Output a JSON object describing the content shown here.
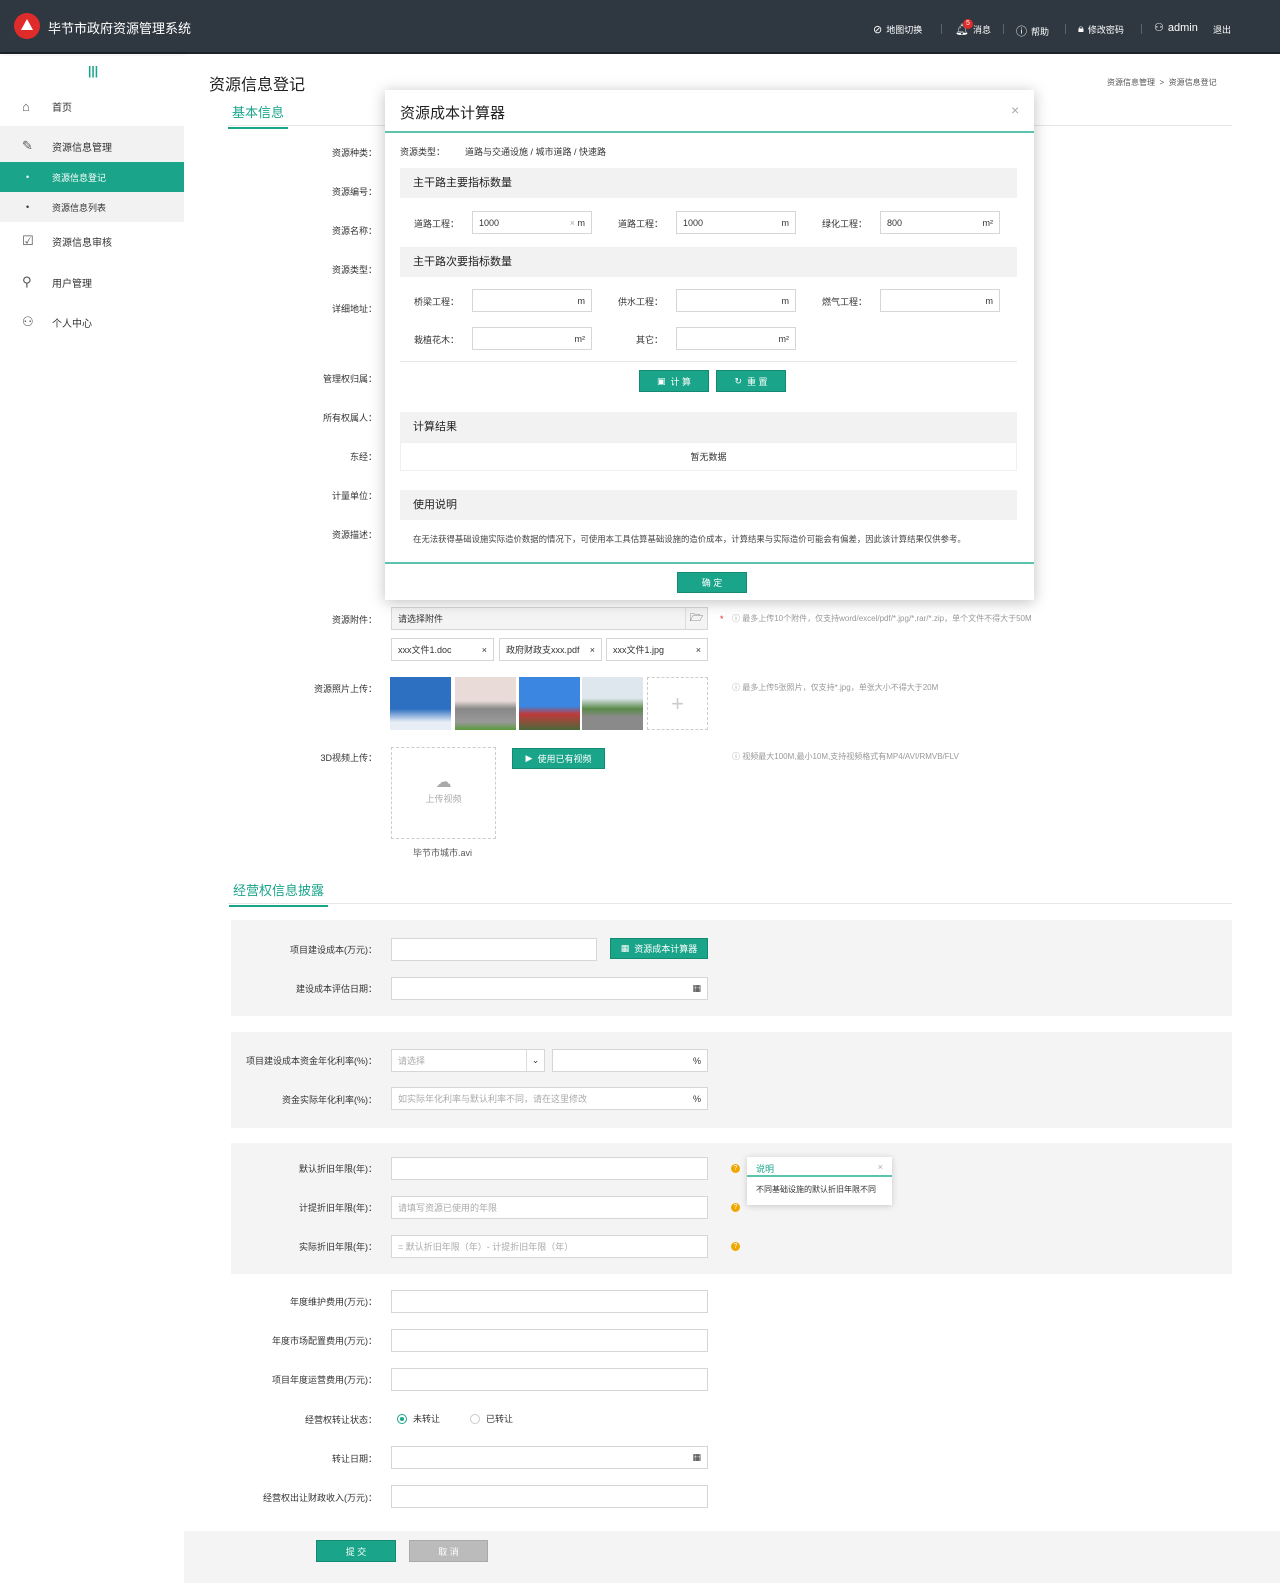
{
  "header": {
    "title": "毕节市政府资源管理系统",
    "nav": [
      {
        "icon": "map-switch-icon",
        "label": "地图切换"
      },
      {
        "icon": "bell-icon",
        "label": "消息",
        "badge": "5"
      },
      {
        "icon": "help-icon",
        "label": "帮助"
      },
      {
        "icon": "lock-icon",
        "label": "修改密码"
      },
      {
        "icon": "user-icon",
        "label": "admin"
      }
    ],
    "logout": "退出"
  },
  "sidebar": {
    "toggle": "|||",
    "items": [
      {
        "icon": "home-icon",
        "label": "首页"
      },
      {
        "icon": "edit-doc-icon",
        "label": "资源信息管理"
      },
      {
        "icon": "audit-icon",
        "label": "资源信息审核"
      },
      {
        "icon": "user-manage-icon",
        "label": "用户管理"
      },
      {
        "icon": "person-icon",
        "label": "个人中心"
      }
    ],
    "subitems": [
      {
        "label": "资源信息登记"
      },
      {
        "label": "资源信息列表"
      }
    ]
  },
  "page": {
    "title": "资源信息登记",
    "breadcrumb": [
      "资源信息管理",
      ">",
      "资源信息登记"
    ],
    "tab_basic": "基本信息",
    "tab_oper": "经营权信息披露"
  },
  "basic": {
    "labels": [
      "资源种类：",
      "资源编号：",
      "资源名称：",
      "资源类型：",
      "详细地址：",
      "管理权归属：",
      "所有权属人：",
      "东经：",
      "计量单位：",
      "资源描述："
    ],
    "attach_label": "资源附件：",
    "attach_placeholder": "请选择附件",
    "attach_tip": "最多上传10个附件，仅支持word/excel/pdf/*.jpg/*.rar/*.zip，单个文件不得大于50M",
    "files": [
      "xxx文件1.doc",
      "政府财政支xxx.pdf",
      "xxx文件1.jpg"
    ],
    "photo_label": "资源照片上传：",
    "photo_tip": "最多上传5张照片，仅支持*.jpg，单张大小不得大于20M",
    "video_label": "3D视频上传：",
    "video_upload": "上传视频",
    "video_use": "使用已有视频",
    "video_tip": "视频最大100M,最小10M,支持视频格式有MP4/AVI/RMVB/FLV",
    "video_file": "毕节市城市.avi"
  },
  "oper": {
    "cost_label": "项目建设成本(万元)：",
    "calc_button": "资源成本计算器",
    "eval_date_label": "建设成本评估日期：",
    "rate_label": "项目建设成本资金年化利率(%)：",
    "rate_select": "请选择",
    "pct": "%",
    "actual_rate_label": "资金实际年化利率(%)：",
    "actual_rate_placeholder": "如实际年化利率与默认利率不同，请在这里修改",
    "dep_default_label": "默认折旧年限(年)：",
    "dep_used_label": "计提折旧年限(年)：",
    "dep_used_placeholder": "请填写资源已使用的年限",
    "dep_actual_label": "实际折旧年限(年)：",
    "dep_actual_placeholder": "= 默认折旧年限（年）- 计提折旧年限（年）",
    "popover_title": "说明",
    "popover_text": "不同基础设施的默认折旧年限不同",
    "maint_label": "年度维护费用(万元)：",
    "market_label": "年度市场配置费用(万元)：",
    "ops_label": "项目年度运营费用(万元)：",
    "status_label": "经营权转让状态：",
    "status_options": [
      "未转让",
      "已转让"
    ],
    "status_selected": "未转让",
    "transfer_date_label": "转让日期：",
    "income_label": "经营权出让财政收入(万元)：",
    "submit": "提 交",
    "cancel": "取 消"
  },
  "modal": {
    "title": "资源成本计算器",
    "close": "×",
    "type_label": "资源类型：",
    "type_value": "道路与交通设施 / 城市道路 / 快速路",
    "main_section": "主干路主要指标数量",
    "main_fields": [
      {
        "label": "道路工程：",
        "value": "1000",
        "unit": "m"
      },
      {
        "label": "道路工程：",
        "value": "1000",
        "unit": "m"
      },
      {
        "label": "绿化工程：",
        "value": "800",
        "unit": "m²"
      }
    ],
    "sec_section": "主干路次要指标数量",
    "sec_fields": [
      {
        "label": "桥梁工程：",
        "unit": "m"
      },
      {
        "label": "供水工程：",
        "unit": "m"
      },
      {
        "label": "燃气工程：",
        "unit": "m"
      },
      {
        "label": "栽植花木：",
        "unit": "m²"
      },
      {
        "label": "其它：",
        "unit": "m²"
      }
    ],
    "calc": "计 算",
    "reset": "重 置",
    "result_section": "计算结果",
    "no_data": "暂无数据",
    "usage_section": "使用说明",
    "usage_text": "在无法获得基础设施实际造价数据的情况下，可使用本工具估算基础设施的造价成本，计算结果与实际造价可能会有偏差，因此该计算结果仅供参考。",
    "ok": "确 定"
  },
  "colors": {
    "accent": "#1aa58a",
    "header": "#2f3841",
    "badge": "#e02b2b"
  }
}
